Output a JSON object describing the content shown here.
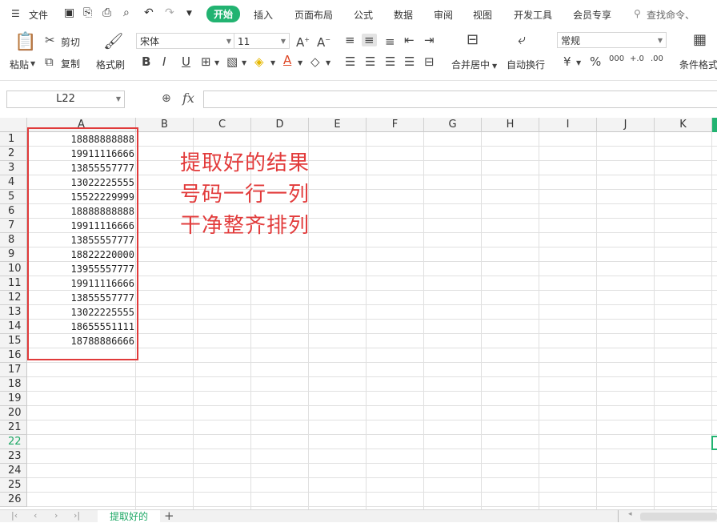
{
  "menu": {
    "file_label": "文件",
    "tabs": [
      "开始",
      "插入",
      "页面布局",
      "公式",
      "数据",
      "审阅",
      "视图",
      "开发工具",
      "会员专享"
    ],
    "search_label": "查找命令、"
  },
  "ribbon": {
    "paste": "粘贴",
    "cut": "剪切",
    "copy": "复制",
    "format_painter": "格式刷",
    "font_name": "宋体",
    "font_size": "11",
    "merge_center": "合并居中",
    "wrap_text": "自动换行",
    "number_format": "常规",
    "conditional_format": "条件格式",
    "currency_symbol": "¥",
    "percent_symbol": "%",
    "thousands_symbol": "000"
  },
  "formula_bar": {
    "name_box": "L22",
    "fx_label": "fx",
    "formula_value": ""
  },
  "grid": {
    "columns": [
      "A",
      "B",
      "C",
      "D",
      "E",
      "F",
      "G",
      "H",
      "I",
      "J",
      "K"
    ],
    "rows": [
      "1",
      "2",
      "3",
      "4",
      "5",
      "6",
      "7",
      "8",
      "9",
      "10",
      "11",
      "12",
      "13",
      "14",
      "15",
      "16",
      "17",
      "18",
      "19",
      "20",
      "21",
      "22",
      "23",
      "24",
      "25",
      "26"
    ],
    "active_row": "22",
    "column_a_values": [
      "18888888888",
      "19911116666",
      "13855557777",
      "13022225555",
      "15522229999",
      "18888888888",
      "19911116666",
      "13855557777",
      "18822220000",
      "13955557777",
      "19911116666",
      "13855557777",
      "13022225555",
      "18655551111",
      "18788886666"
    ]
  },
  "annotation": {
    "line1": "提取好的结果",
    "line2": "号码一行一列",
    "line3": "干净整齐排列",
    "color": "#e23b3b"
  },
  "sheet": {
    "tab_name": "提取好的"
  },
  "colors": {
    "accent": "#22b371",
    "highlight_box": "#e03a3a"
  }
}
